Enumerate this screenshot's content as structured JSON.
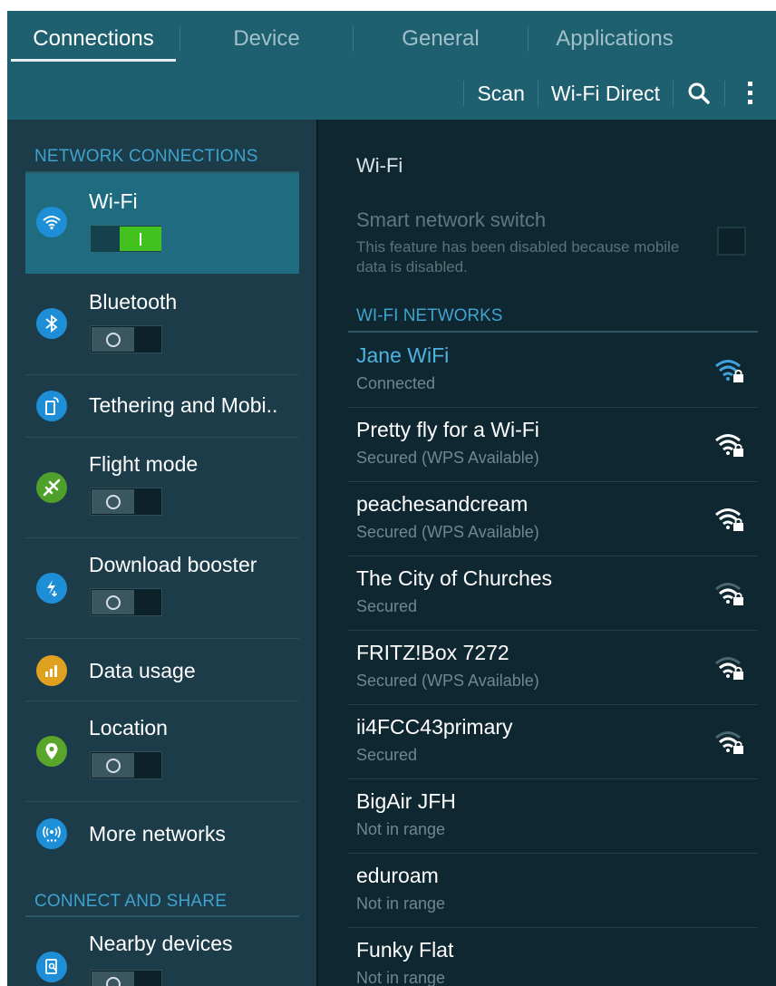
{
  "tabs": [
    "Connections",
    "Device",
    "General",
    "Applications"
  ],
  "actions": {
    "scan": "Scan",
    "wifi_direct": "Wi-Fi Direct"
  },
  "sidebar": {
    "section_network": "NETWORK CONNECTIONS",
    "section_share": "CONNECT AND SHARE",
    "items": [
      {
        "label": "Wi-Fi",
        "toggle": "on",
        "icon": "wifi-icon",
        "color": "#1e8fd6"
      },
      {
        "label": "Bluetooth",
        "toggle": "off",
        "icon": "bluetooth-icon",
        "color": "#1e8fd6"
      },
      {
        "label": "Tethering and Mobi..",
        "icon": "tethering-icon",
        "color": "#1e8fd6"
      },
      {
        "label": "Flight mode",
        "toggle": "off",
        "icon": "airplane-icon",
        "color": "#4ea02a"
      },
      {
        "label": "Download booster",
        "toggle": "off",
        "icon": "download-booster-icon",
        "color": "#1e8fd6"
      },
      {
        "label": "Data usage",
        "icon": "data-usage-icon",
        "color": "#e0a020"
      },
      {
        "label": "Location",
        "toggle": "off",
        "icon": "location-pin-icon",
        "color": "#5aa62a"
      },
      {
        "label": "More networks",
        "icon": "more-networks-icon",
        "color": "#1e8fd6"
      },
      {
        "label": "Nearby devices",
        "toggle": "off",
        "icon": "nearby-devices-icon",
        "color": "#1e8fd6"
      }
    ]
  },
  "main": {
    "title": "Wi-Fi",
    "smart_switch": {
      "title": "Smart network switch",
      "description": "This feature has been disabled because mobile data is disabled."
    },
    "networks_header": "WI-FI NETWORKS",
    "networks": [
      {
        "name": "Jane WiFi",
        "status": "Connected",
        "signal": "strong-locked-blue"
      },
      {
        "name": "Pretty fly for a Wi-Fi",
        "status": "Secured (WPS Available)",
        "signal": "strong-locked"
      },
      {
        "name": "peachesandcream",
        "status": "Secured (WPS Available)",
        "signal": "strong-locked"
      },
      {
        "name": "The City of Churches",
        "status": "Secured",
        "signal": "medium-locked"
      },
      {
        "name": "FRITZ!Box 7272",
        "status": "Secured (WPS Available)",
        "signal": "medium-locked"
      },
      {
        "name": "ii4FCC43primary",
        "status": "Secured",
        "signal": "medium-locked"
      },
      {
        "name": "BigAir JFH",
        "status": "Not in range"
      },
      {
        "name": "eduroam",
        "status": "Not in range"
      },
      {
        "name": "Funky Flat",
        "status": "Not in range"
      }
    ]
  }
}
